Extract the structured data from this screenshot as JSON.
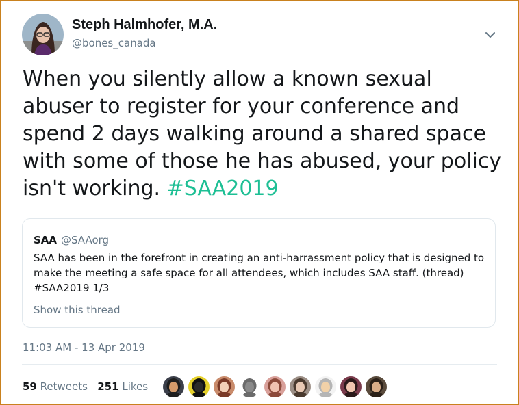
{
  "tweet": {
    "author": {
      "display_name": "Steph Halmhofer, M.A.",
      "handle": "@bones_canada"
    },
    "text": "When you silently allow a known sexual abuser to register for your conference and spend 2 days walking around a shared space with some of those he has abused, your policy isn't working.",
    "hashtag": "#SAA2019",
    "timestamp": "11:03 AM - 13 Apr 2019",
    "stats": {
      "retweets_count": "59",
      "retweets_label": "Retweets",
      "likes_count": "251",
      "likes_label": "Likes"
    }
  },
  "quoted_tweet": {
    "author_name": "SAA",
    "author_handle": "@SAAorg",
    "text": "SAA has been in the forefront in creating an anti-harrassment policy that is designed to make the meeting a safe space for all attendees, which includes SAA staff.  (thread) #SAA2019 1/3",
    "show_thread_label": "Show this thread"
  },
  "likers": [
    {
      "name": "liker-1",
      "bg": "#3b3f4a",
      "fg": "#d49a6a",
      "hair": "#1e1e1e"
    },
    {
      "name": "liker-2",
      "bg": "#e6d12b",
      "fg": "#2a2a2a",
      "hair": "#111111"
    },
    {
      "name": "liker-3",
      "bg": "#c98b6b",
      "fg": "#f2d0b8",
      "hair": "#7a3a28"
    },
    {
      "name": "liker-4",
      "bg": "#ffffff",
      "fg": "#8a8a8a",
      "hair": "#6b6b6b"
    },
    {
      "name": "liker-5",
      "bg": "#d9a09a",
      "fg": "#f0c2b0",
      "hair": "#8c4a3a"
    },
    {
      "name": "liker-6",
      "bg": "#9c8f86",
      "fg": "#e8c9b4",
      "hair": "#4a3a2e"
    },
    {
      "name": "liker-7",
      "bg": "#f3f3f3",
      "fg": "#f1d1a8",
      "hair": "#b5b5b5"
    },
    {
      "name": "liker-8",
      "bg": "#7a3b4c",
      "fg": "#f0c6b0",
      "hair": "#2b1a1a"
    },
    {
      "name": "liker-9",
      "bg": "#5a4b3c",
      "fg": "#d9ad88",
      "hair": "#2b2018"
    }
  ],
  "colors": {
    "hashtag": "#1dbf94",
    "muted": "#657786",
    "text": "#14171a",
    "border": "#e1e8ed",
    "frame": "#c9811e"
  }
}
